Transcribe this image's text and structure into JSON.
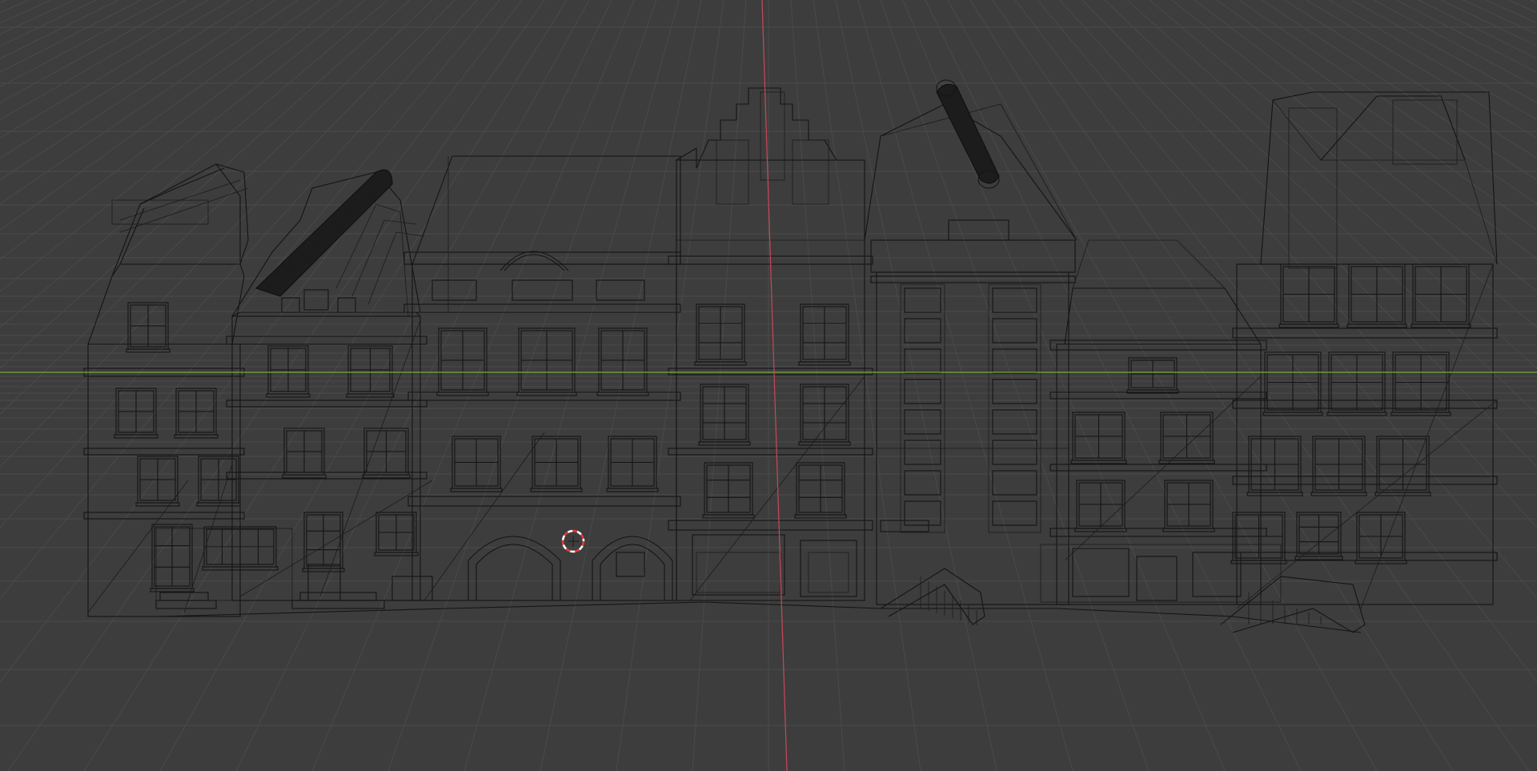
{
  "viewport": {
    "mode": "wireframe",
    "object": "townhouse-row",
    "buildings": 7
  },
  "colors": {
    "background": "#3d3d3d",
    "grid": "#4a4a4a",
    "x_axis": "#7aa93a",
    "y_axis": "#c8485a",
    "wireframe": "#141414",
    "cursor_red": "#e23b3b",
    "cursor_white": "#ffffff"
  },
  "icons": {
    "cursor": "3d-cursor-icon"
  }
}
